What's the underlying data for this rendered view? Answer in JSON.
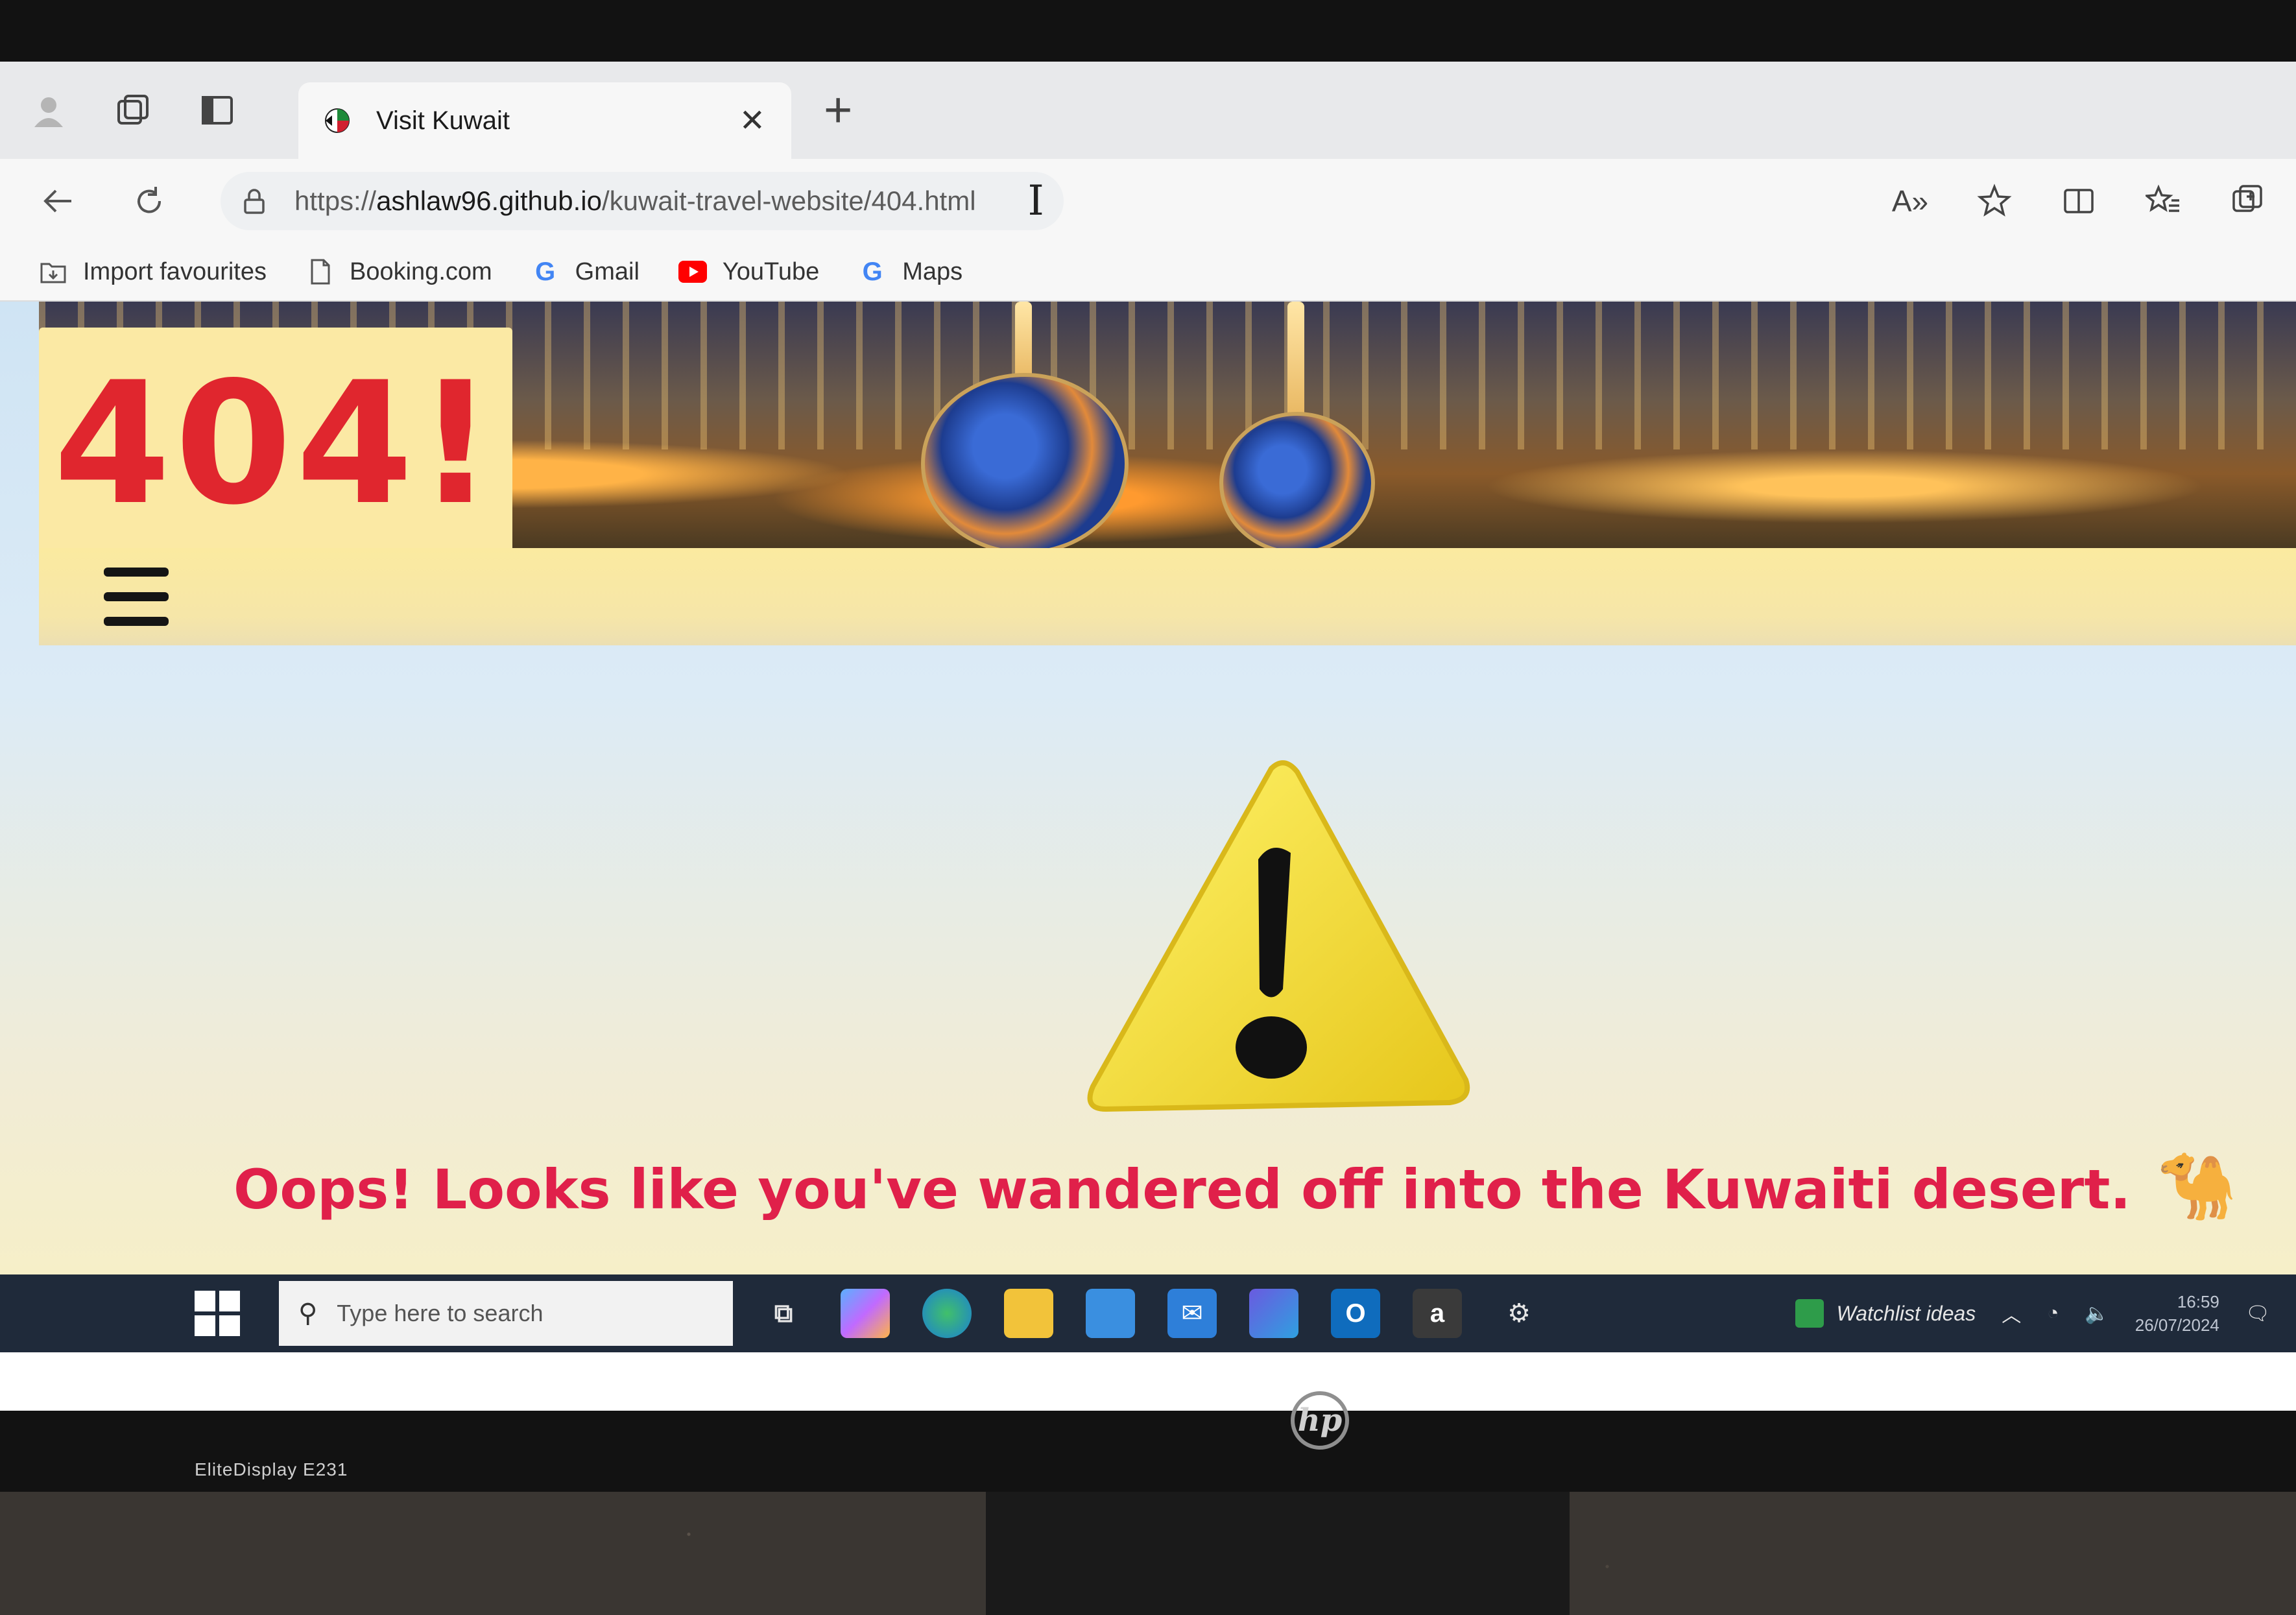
{
  "browser": {
    "tab": {
      "title": "Visit Kuwait"
    },
    "address": {
      "scheme": "https://",
      "host": "ashlaw96.github.io",
      "path": "/kuwait-travel-website/404.html",
      "caret": "I"
    },
    "bookmarks": [
      {
        "label": "Import favourites",
        "icon": "import-icon"
      },
      {
        "label": "Booking.com",
        "icon": "page-icon"
      },
      {
        "label": "Gmail",
        "icon": "google-icon"
      },
      {
        "label": "YouTube",
        "icon": "youtube-icon"
      },
      {
        "label": "Maps",
        "icon": "google-icon"
      }
    ],
    "read_aloud_label": "A»"
  },
  "page": {
    "badge": "404!",
    "message": "Oops! Looks like you've wandered off into the Kuwaiti desert.",
    "emoji": "🐪"
  },
  "taskbar": {
    "search_placeholder": "Type here to search",
    "amazon_app_label": "a",
    "watchlist": "Watchlist ideas",
    "time": "16:59",
    "date": "26/07/2024"
  },
  "monitor": {
    "model": "EliteDisplay E231",
    "brand": "hp"
  },
  "colors": {
    "accent_red": "#e0262e",
    "message_red": "#e0204a",
    "menu_strip": "#fbeaa0"
  }
}
